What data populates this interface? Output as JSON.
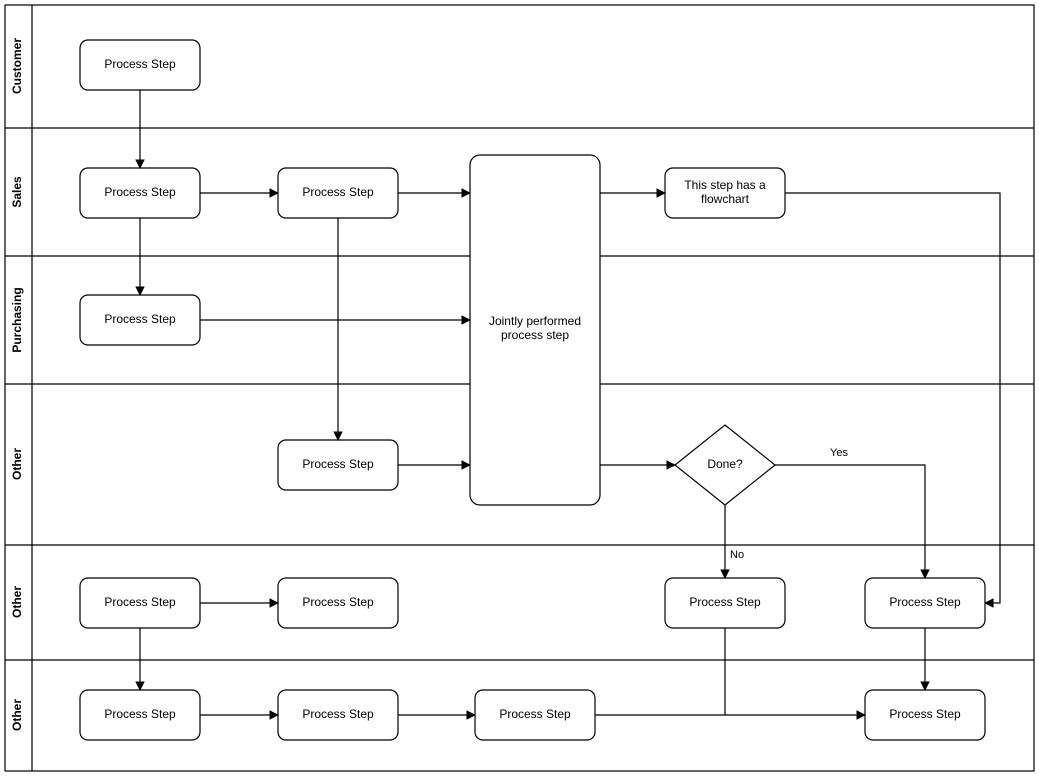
{
  "chart_data": {
    "type": "swimlane-flowchart",
    "lanes": [
      {
        "id": "customer",
        "label": "Customer"
      },
      {
        "id": "sales",
        "label": "Sales"
      },
      {
        "id": "purchasing",
        "label": "Purchasing"
      },
      {
        "id": "other1",
        "label": "Other"
      },
      {
        "id": "other2",
        "label": "Other"
      },
      {
        "id": "other3",
        "label": "Other"
      }
    ],
    "nodes": {
      "n1": {
        "label": "Process Step",
        "lane": "customer",
        "shape": "process"
      },
      "n2": {
        "label": "Process Step",
        "lane": "sales",
        "shape": "process"
      },
      "n3": {
        "label": "Process Step",
        "lane": "sales",
        "shape": "process"
      },
      "n4": {
        "label": "This step has a flowchart",
        "lane": "sales",
        "shape": "process"
      },
      "n5": {
        "label": "Process Step",
        "lane": "purchasing",
        "shape": "process"
      },
      "n6": {
        "label": "Jointly performed process step",
        "lane": "sales/purchasing/other1",
        "shape": "process"
      },
      "n7": {
        "label": "Process Step",
        "lane": "other1",
        "shape": "process"
      },
      "d1": {
        "label": "Done?",
        "lane": "other1",
        "shape": "decision"
      },
      "n8": {
        "label": "Process Step",
        "lane": "other2",
        "shape": "process"
      },
      "n9": {
        "label": "Process Step",
        "lane": "other2",
        "shape": "process"
      },
      "n10": {
        "label": "Process Step",
        "lane": "other2",
        "shape": "process"
      },
      "n11": {
        "label": "Process Step",
        "lane": "other2",
        "shape": "process"
      },
      "n12": {
        "label": "Process Step",
        "lane": "other3",
        "shape": "process"
      },
      "n13": {
        "label": "Process Step",
        "lane": "other3",
        "shape": "process"
      },
      "n14": {
        "label": "Process Step",
        "lane": "other3",
        "shape": "process"
      },
      "n15": {
        "label": "Process Step",
        "lane": "other3",
        "shape": "process"
      }
    },
    "edges": [
      {
        "from": "n1",
        "to": "n2"
      },
      {
        "from": "n2",
        "to": "n3"
      },
      {
        "from": "n2",
        "to": "n5"
      },
      {
        "from": "n3",
        "to": "n6"
      },
      {
        "from": "n3",
        "to": "n7"
      },
      {
        "from": "n5",
        "to": "n6"
      },
      {
        "from": "n7",
        "to": "n6"
      },
      {
        "from": "n6",
        "to": "n4"
      },
      {
        "from": "n6",
        "to": "d1"
      },
      {
        "from": "d1",
        "to": "n11",
        "label": "Yes"
      },
      {
        "from": "d1",
        "to": "n10",
        "label": "No"
      },
      {
        "from": "n4",
        "to": "n11"
      },
      {
        "from": "n8",
        "to": "n9"
      },
      {
        "from": "n8",
        "to": "n12"
      },
      {
        "from": "n10",
        "to": "n15"
      },
      {
        "from": "n11",
        "to": "n15"
      },
      {
        "from": "n12",
        "to": "n13"
      },
      {
        "from": "n13",
        "to": "n14"
      },
      {
        "from": "n14",
        "to": "n15"
      }
    ],
    "edge_labels": {
      "yes": "Yes",
      "no": "No"
    }
  }
}
